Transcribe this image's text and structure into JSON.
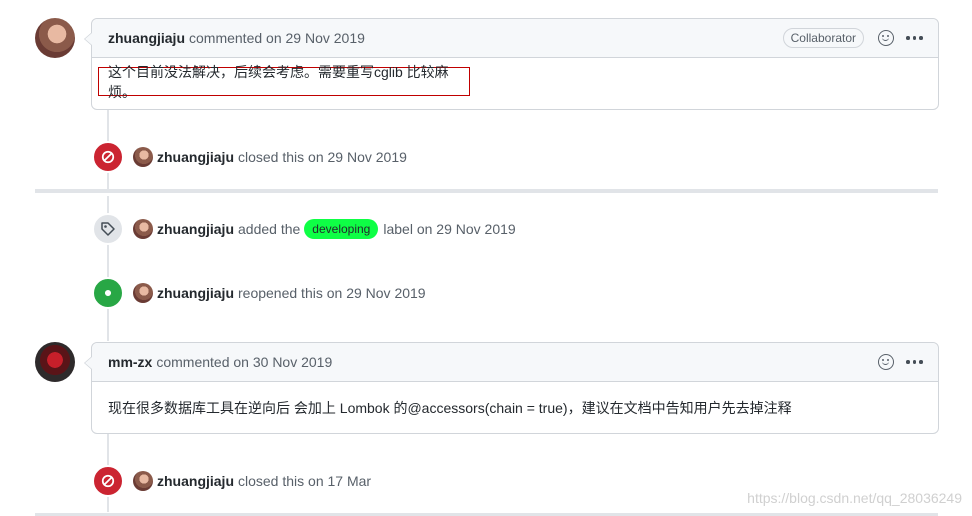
{
  "comments": [
    {
      "author": "zhuangjiaju",
      "meta": "commented on 29 Nov 2019",
      "badge": "Collaborator",
      "body": "这个目前没法解决，后续会考虑。需要重写cglib 比较麻烦。"
    },
    {
      "author": "mm-zx",
      "meta": "commented on 30 Nov 2019",
      "body": "现在很多数据库工具在逆向后 会加上 Lombok 的@accessors(chain = true)，建议在文档中告知用户先去掉注释"
    }
  ],
  "events": {
    "closed1": {
      "author": "zhuangjiaju",
      "text": "closed this on 29 Nov 2019"
    },
    "labeled": {
      "author": "zhuangjiaju",
      "prefix": "added the",
      "label": "developing",
      "suffix": "label on 29 Nov 2019",
      "label_color": "#0eff45"
    },
    "reopened": {
      "author": "zhuangjiaju",
      "text": "reopened this on 29 Nov 2019"
    },
    "closed2": {
      "author": "zhuangjiaju",
      "text": "closed this on 17 Mar"
    }
  },
  "icons": {
    "closed": "circle-slash-icon",
    "label": "tag-icon",
    "reopened": "dot-fill-icon",
    "emoji": "smiley-icon",
    "menu": "kebab-horizontal-icon"
  },
  "colors": {
    "closed": "#cb2431",
    "reopened": "#28a745",
    "highlight_border": "#c00000"
  },
  "watermark": "https://blog.csdn.net/qq_28036249"
}
